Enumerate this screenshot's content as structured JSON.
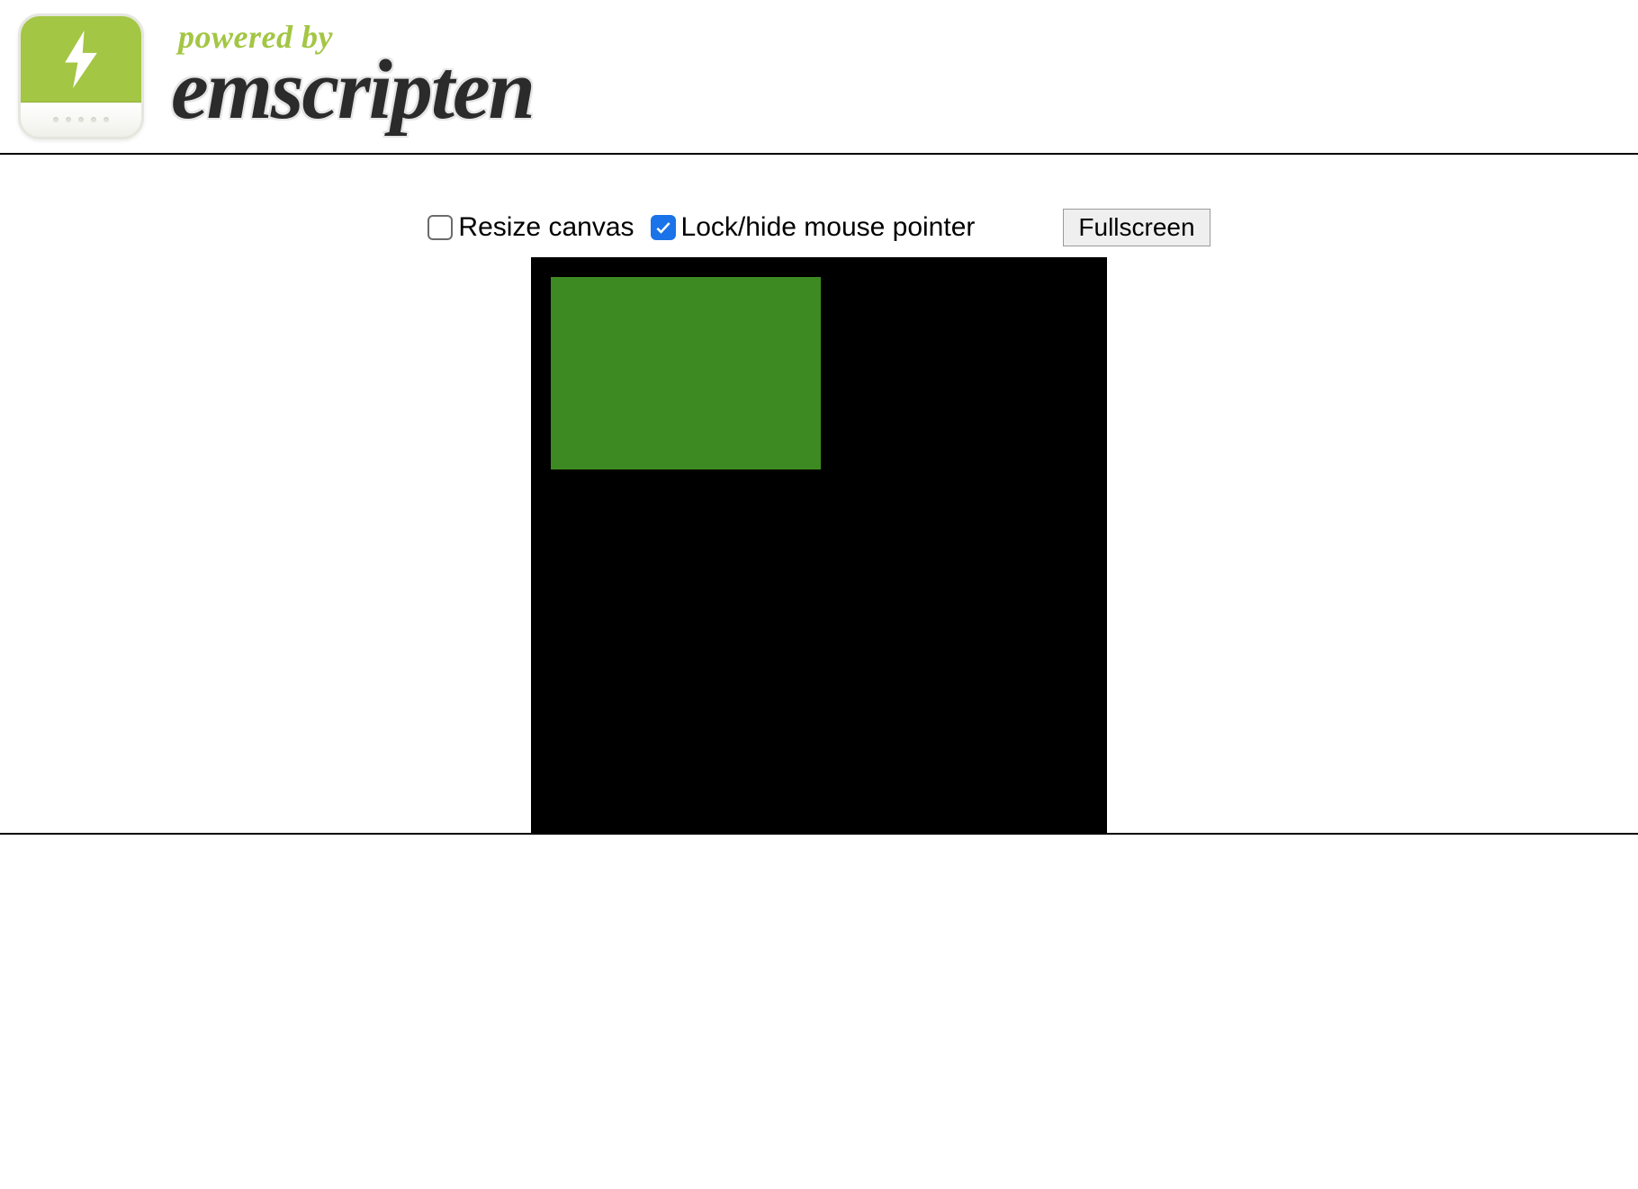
{
  "header": {
    "powered_by": "powered by",
    "brand": "emscripten",
    "logo_icon": "lightning-icon"
  },
  "controls": {
    "resize_canvas": {
      "label": "Resize canvas",
      "checked": false
    },
    "lock_pointer": {
      "label": "Lock/hide mouse pointer",
      "checked": true
    },
    "fullscreen_label": "Fullscreen"
  },
  "canvas": {
    "bg_color": "#000000",
    "rect_color": "#3d8a22"
  }
}
